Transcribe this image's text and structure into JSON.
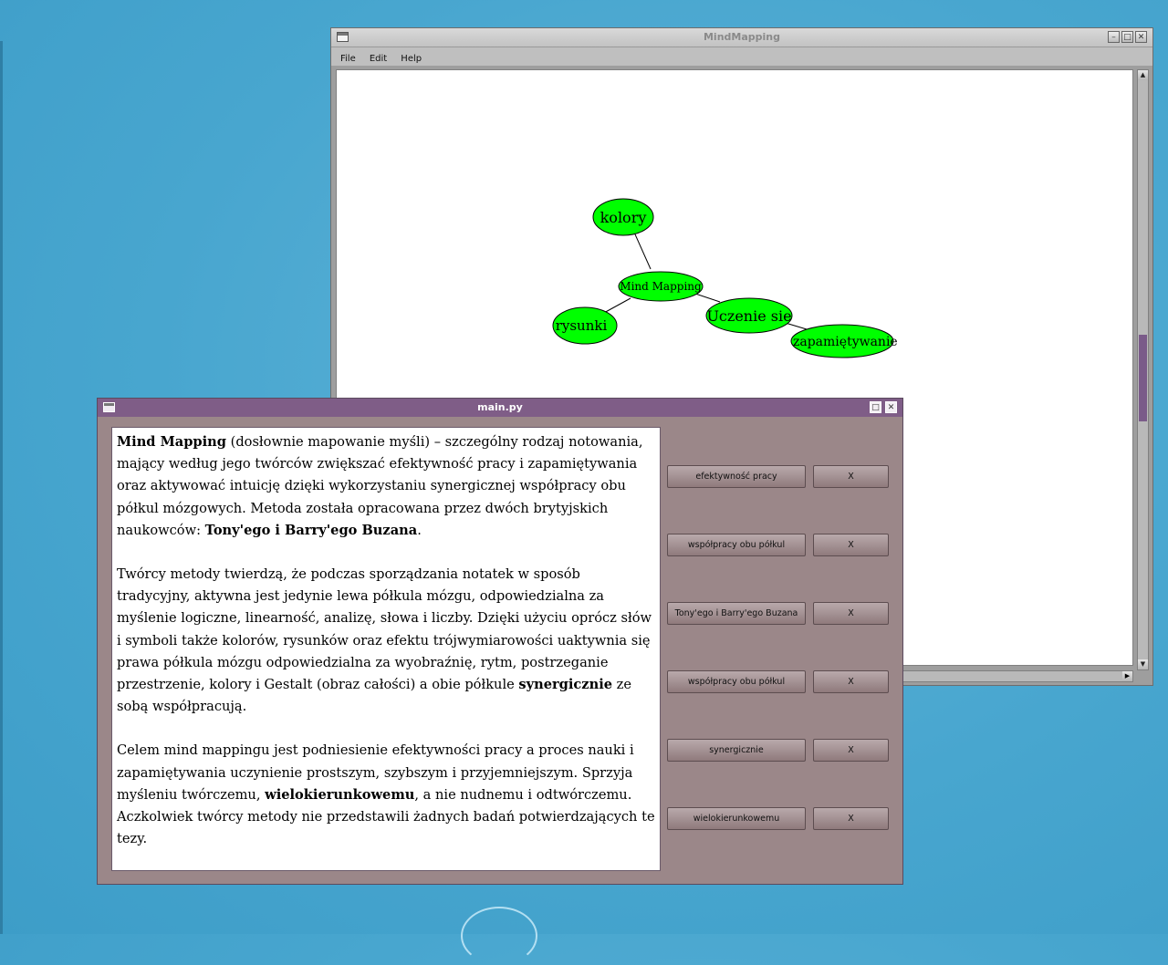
{
  "mindmap_window": {
    "title": "MindMapping",
    "menu": [
      "File",
      "Edit",
      "Help"
    ],
    "nodes": {
      "root": "Mind Mapping",
      "n1": "kolory",
      "n2": "rysunki",
      "n3": "Uczenie sie",
      "n4": "zapamiętywanie"
    },
    "node_color": "#00ff00"
  },
  "main_window": {
    "title": "main.py",
    "paragraphs": [
      [
        {
          "b": true,
          "t": "Mind Mapping"
        },
        {
          "b": false,
          "t": " (dosłownie mapowanie myśli) – szczególny rodzaj notowania, mający według jego twórców zwiększać efektywność pracy i zapamiętywania oraz aktywować intuicję dzięki wykorzystaniu synergicznej współpracy obu półkul mózgowych. Metoda została opracowana przez dwóch brytyjskich naukowców: "
        },
        {
          "b": true,
          "t": "Tony'ego i Barry'ego Buzana"
        },
        {
          "b": false,
          "t": "."
        }
      ],
      [
        {
          "b": false,
          "t": "Twórcy metody twierdzą, że podczas sporządzania notatek w sposób tradycyjny, aktywna jest jedynie lewa półkula mózgu, odpowiedzialna za myślenie logiczne, linearność, analizę, słowa i liczby. Dzięki użyciu oprócz słów i symboli także kolorów, rysunków oraz efektu trójwymiarowości uaktywnia się prawa półkula mózgu odpowiedzialna za wyobraźnię, rytm, postrzeganie przestrzenie, kolory i Gestalt (obraz całości) a obie półkule "
        },
        {
          "b": true,
          "t": "synergicznie"
        },
        {
          "b": false,
          "t": " ze sobą współpracują."
        }
      ],
      [
        {
          "b": false,
          "t": "Celem mind mappingu jest podniesienie efektywności pracy a proces nauki i zapamiętywania uczynienie prostszym, szybszym i przyjemniejszym. Sprzyja myśleniu twórczemu, "
        },
        {
          "b": true,
          "t": "wielokierunkowemu"
        },
        {
          "b": false,
          "t": ", a nie nudnemu i odtwórczemu. Aczkolwiek twórcy metody nie przedstawili żadnych badań potwierdzających te tezy."
        }
      ]
    ],
    "keyword_buttons": [
      {
        "label": "efektywność pracy",
        "remove": "X"
      },
      {
        "label": "współpracy obu półkul",
        "remove": "X"
      },
      {
        "label": "Tony'ego i Barry'ego Buzana",
        "remove": "X"
      },
      {
        "label": "współpracy obu półkul",
        "remove": "X"
      },
      {
        "label": "synergicznie",
        "remove": "X"
      },
      {
        "label": "wielokierunkowemu",
        "remove": "X"
      }
    ]
  }
}
